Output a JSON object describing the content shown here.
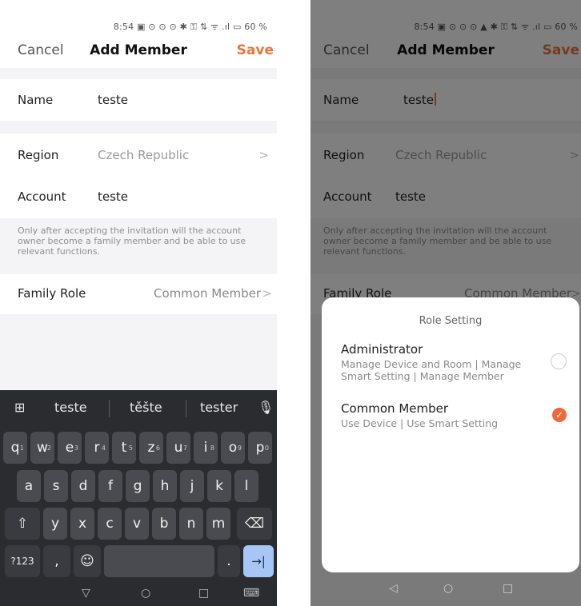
{
  "left": {
    "status": "8:54 ▣ ⊙ ⊙ ⊙ ✱ ⚿ ⇅ ᯤ .ıl ▭ 60 %",
    "header": {
      "cancel": "Cancel",
      "title": "Add Member",
      "save": "Save"
    },
    "form": {
      "name_label": "Name",
      "name_value": "teste",
      "region_label": "Region",
      "region_value": "Czech Republic",
      "account_label": "Account",
      "account_value": "teste",
      "note": "Only after accepting the invitation will the account owner become a family member and be able to use relevant functions.",
      "role_label": "Family Role",
      "role_value": "Common Member"
    },
    "keyboard": {
      "suggestions": [
        "teste",
        "těšte",
        "tester"
      ],
      "row1": [
        {
          "k": "q",
          "s": "1"
        },
        {
          "k": "w",
          "s": "2"
        },
        {
          "k": "e",
          "s": "3"
        },
        {
          "k": "r",
          "s": "4"
        },
        {
          "k": "t",
          "s": "5"
        },
        {
          "k": "z",
          "s": "6"
        },
        {
          "k": "u",
          "s": "7"
        },
        {
          "k": "i",
          "s": "8"
        },
        {
          "k": "o",
          "s": "9"
        },
        {
          "k": "p",
          "s": "0"
        }
      ],
      "row2": [
        "a",
        "s",
        "d",
        "f",
        "g",
        "h",
        "j",
        "k",
        "l"
      ],
      "row3": [
        "y",
        "x",
        "c",
        "v",
        "b",
        "n",
        "m"
      ],
      "symbols_key": "?123",
      "comma_key": ",",
      "emoji_key": "☺",
      "period_key": ".",
      "enter_key": "→|",
      "shift_key": "⇧",
      "backspace_key": "⌫",
      "apps_key": "⊞",
      "mic_key": "🎙"
    },
    "nav": {
      "back": "▽",
      "home": "○",
      "recents": "□",
      "keyboard": "⌨"
    }
  },
  "right": {
    "status": "8:54 ▣ ⊙ ⊙ ⊙ ▲ ✱ ⚿ ⇅ ᯤ .ıl ▭ 60 %",
    "header": {
      "cancel": "Cancel",
      "title": "Add Member",
      "save": "Save"
    },
    "form": {
      "name_label": "Name",
      "name_value": "teste",
      "region_label": "Region",
      "region_value": "Czech Republic",
      "account_label": "Account",
      "account_value": "teste",
      "note": "Only after accepting the invitation will the account owner become a family member and be able to use relevant functions.",
      "role_label": "Family Role",
      "role_value": "Common Member"
    },
    "sheet": {
      "title": "Role Setting",
      "options": [
        {
          "name": "Administrator",
          "desc": "Manage Device and Room | Manage Smart Setting | Manage Member",
          "selected": false
        },
        {
          "name": "Common Member",
          "desc": "Use Device | Use Smart Setting",
          "selected": true
        }
      ],
      "check": "✓"
    },
    "nav": {
      "back": "◁",
      "home": "○",
      "recents": "□"
    }
  },
  "colors": {
    "accent": "#e8763a",
    "selected": "#ef6a3a",
    "keyboard_bg": "#2b2c30"
  }
}
